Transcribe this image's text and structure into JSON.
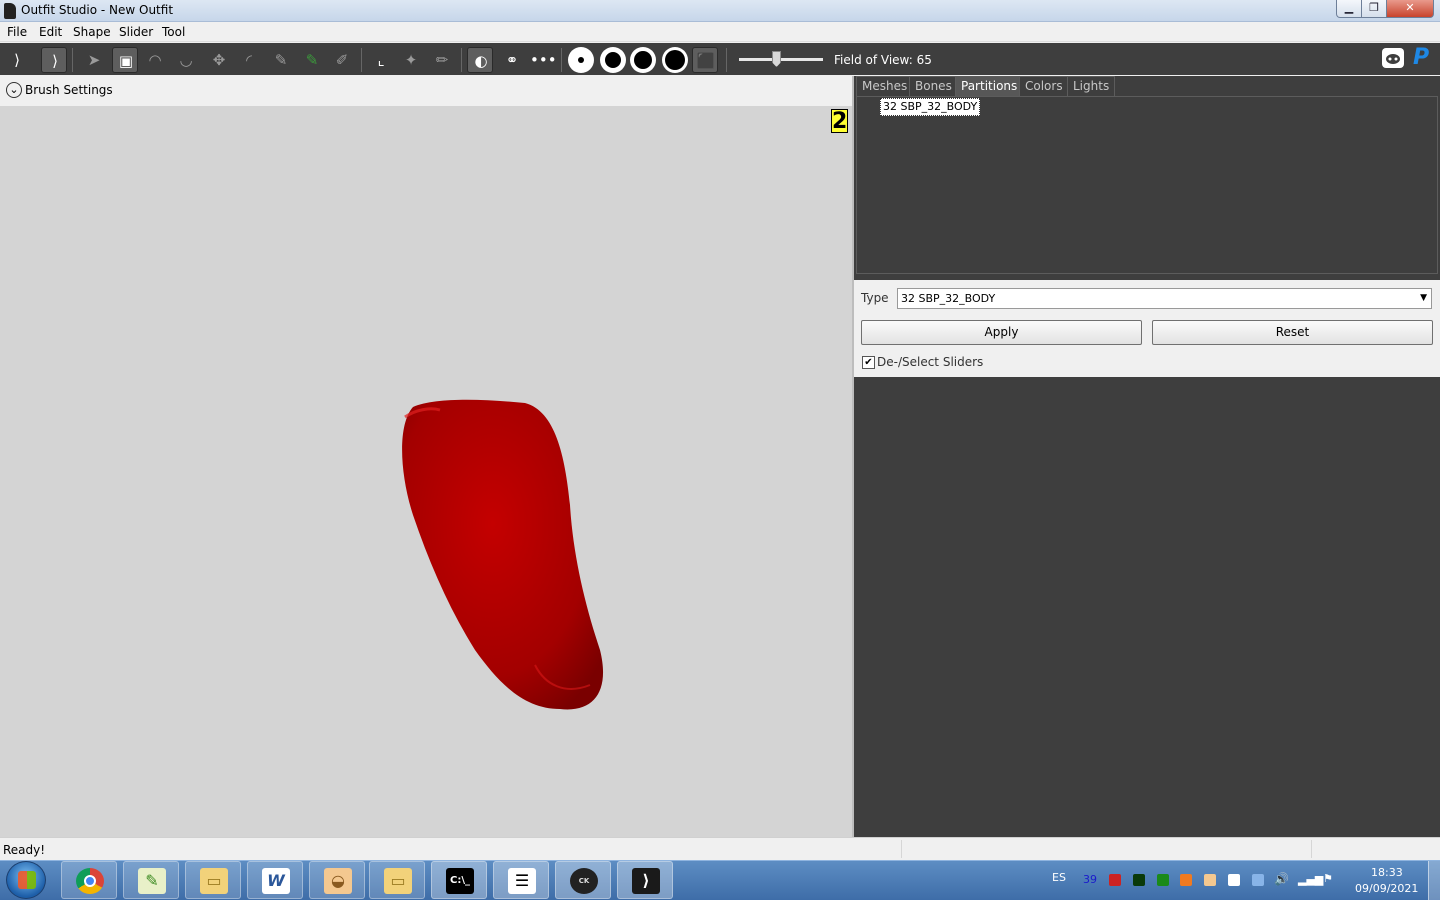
{
  "window": {
    "title": "Outfit Studio - New Outfit"
  },
  "menu": {
    "items": [
      "File",
      "Edit",
      "Shape",
      "Slider",
      "Tool"
    ]
  },
  "toolbar": {
    "fov_label": "Field of View: 65",
    "fov_value": 65
  },
  "viewport": {
    "brush_settings_label": "Brush Settings",
    "symmetry_badge": "2",
    "mesh_color": "#b00000",
    "background": "#d4d4d4"
  },
  "tabs": [
    "Meshes",
    "Bones",
    "Partitions",
    "Colors",
    "Lights"
  ],
  "active_tab": "Partitions",
  "partitions": {
    "items": [
      "32 SBP_32_BODY"
    ]
  },
  "partition_props": {
    "type_label": "Type",
    "type_value": "32 SBP_32_BODY",
    "apply_label": "Apply",
    "reset_label": "Reset",
    "deselect_sliders_label": "De-/Select Sliders",
    "deselect_sliders_checked": true
  },
  "status": {
    "text": "Ready!"
  },
  "taskbar": {
    "apps": [
      "chrome-icon",
      "notepad-plus-icon",
      "folder-icon",
      "word-icon",
      "nifskope-icon",
      "folder-icon",
      "terminal-icon",
      "document-icon",
      "creation-kit-icon",
      "outfit-studio-icon"
    ],
    "language": "ES",
    "tray_number": "39",
    "time": "18:33",
    "date": "09/09/2021"
  }
}
